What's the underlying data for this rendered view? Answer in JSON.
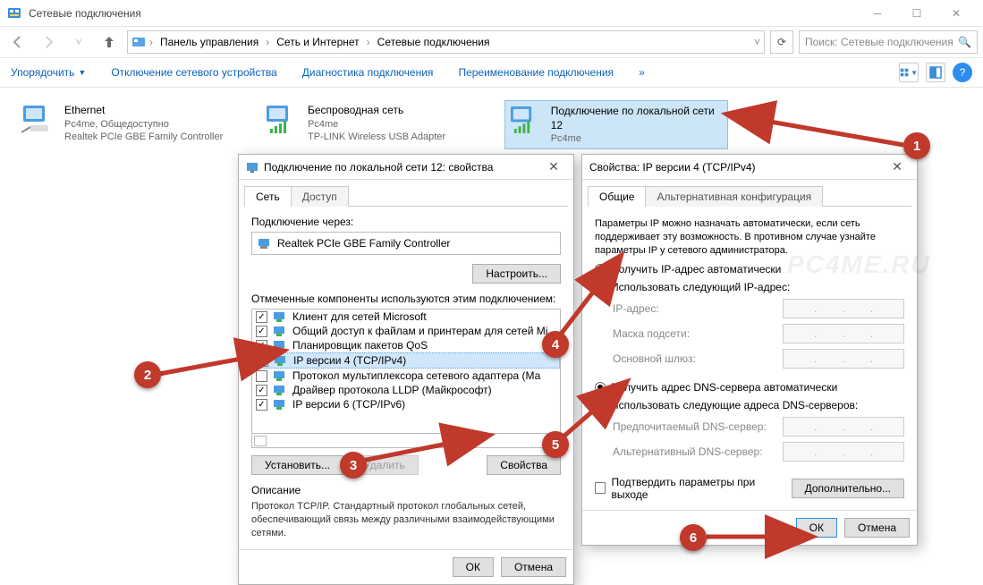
{
  "window": {
    "title": "Сетевые подключения",
    "breadcrumb": [
      "Панель управления",
      "Сеть и Интернет",
      "Сетевые подключения"
    ],
    "search_placeholder": "Поиск: Сетевые подключения"
  },
  "cmdbar": {
    "organize": "Упорядочить",
    "disable": "Отключение сетевого устройства",
    "diagnose": "Диагностика подключения",
    "rename": "Переименование подключения",
    "more": "»"
  },
  "connections": [
    {
      "name": "Ethernet",
      "sub1": "Pc4me, Общедоступно",
      "sub2": "Realtek PCIe GBE Family Controller",
      "selected": false
    },
    {
      "name": "Беспроводная сеть",
      "sub1": "Pc4me",
      "sub2": "TP-LINK Wireless USB Adapter",
      "selected": false
    },
    {
      "name": "Подключение по локальной сети 12",
      "sub1": "Pc4me",
      "sub2": "",
      "selected": true
    }
  ],
  "propsDialog": {
    "title": "Подключение по локальной сети 12: свойства",
    "tabs": [
      "Сеть",
      "Доступ"
    ],
    "connect_via_label": "Подключение через:",
    "adapter": "Realtek PCIe GBE Family Controller",
    "configure": "Настроить...",
    "components_label": "Отмеченные компоненты используются этим подключением:",
    "components": [
      {
        "checked": true,
        "label": "Клиент для сетей Microsoft",
        "sel": false
      },
      {
        "checked": true,
        "label": "Общий доступ к файлам и принтерам для сетей Mi",
        "sel": false
      },
      {
        "checked": true,
        "label": "Планировщик пакетов QoS",
        "sel": false
      },
      {
        "checked": true,
        "label": "IP версии 4 (TCP/IPv4)",
        "sel": true
      },
      {
        "checked": false,
        "label": "Протокол мультиплексора сетевого адаптера (Ма",
        "sel": false
      },
      {
        "checked": true,
        "label": "Драйвер протокола LLDP (Майкрософт)",
        "sel": false
      },
      {
        "checked": true,
        "label": "IP версии 6 (TCP/IPv6)",
        "sel": false
      }
    ],
    "install": "Установить...",
    "uninstall": "Удалить",
    "properties": "Свойства",
    "desc_title": "Описание",
    "desc_text": "Протокол TCP/IP. Стандартный протокол глобальных сетей, обеспечивающий связь между различными взаимодействующими сетями.",
    "ok": "ОК",
    "cancel": "Отмена"
  },
  "ipv4Dialog": {
    "title": "Свойства: IP версии 4 (TCP/IPv4)",
    "tabs": [
      "Общие",
      "Альтернативная конфигурация"
    ],
    "topText": "Параметры IP можно назначать автоматически, если сеть поддерживает эту возможность. В противном случае узнайте параметры IP у сетевого администратора.",
    "r_auto_ip": "Получить IP-адрес автоматически",
    "r_manual_ip": "Использовать следующий IP-адрес:",
    "ip_label": "IP-адрес:",
    "mask_label": "Маска подсети:",
    "gw_label": "Основной шлюз:",
    "r_auto_dns": "Получить адрес DNS-сервера автоматически",
    "r_manual_dns": "Использовать следующие адреса DNS-серверов:",
    "dns1_label": "Предпочитаемый DNS-сервер:",
    "dns2_label": "Альтернативный DNS-сервер:",
    "validate": "Подтвердить параметры при выходе",
    "advanced": "Дополнительно...",
    "ok": "ОК",
    "cancel": "Отмена"
  },
  "callouts": [
    "1",
    "2",
    "3",
    "4",
    "5",
    "6"
  ],
  "watermark": "PC4ME.RU"
}
